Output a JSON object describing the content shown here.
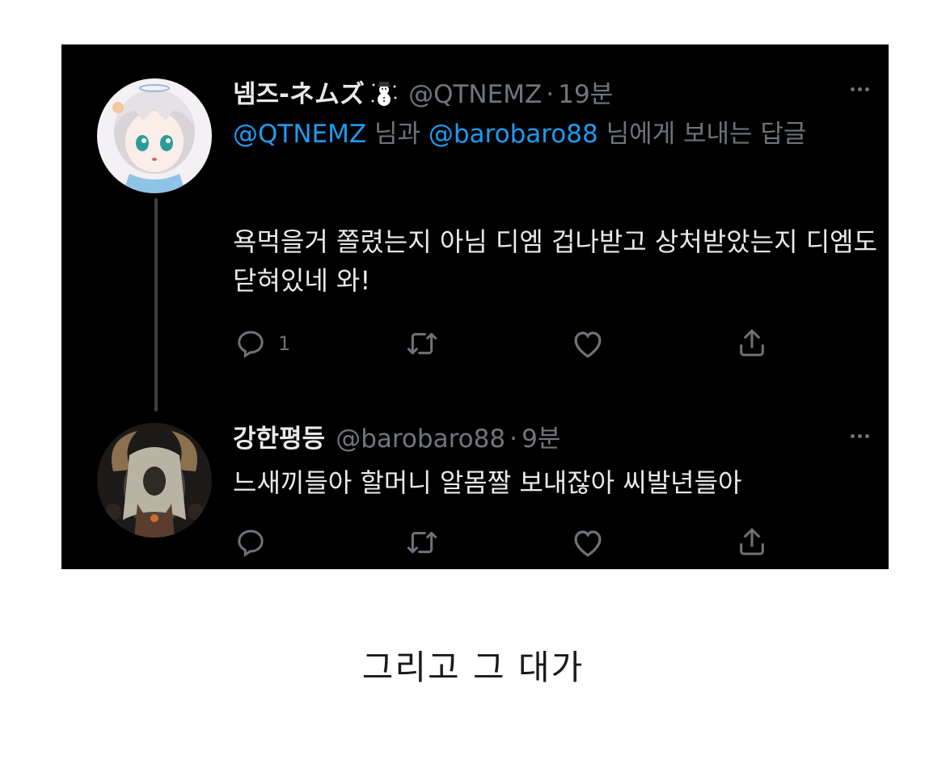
{
  "tweets": [
    {
      "display_name": "넴즈-ネムズ",
      "emoji": "snowman-icon",
      "handle": "@QTNEMZ",
      "separator": "·",
      "time": "19분",
      "reply_to": {
        "user1": "@QTNEMZ",
        "conj1": " 님과 ",
        "user2": "@barobaro88",
        "suffix": " 님에게 보내는 답글"
      },
      "text": "욕먹을거 쫄렸는지 아님 디엠 겁나받고 상처받았는지 디엠도 닫혀있네 와!",
      "reply_count": "1"
    },
    {
      "display_name": "강한평등",
      "handle": "@barobaro88",
      "separator": "·",
      "time": "9분",
      "text": "느새끼들아 할머니 알몸짤 보내잖아 씨발년들아"
    }
  ],
  "caption": "그리고 그 대가",
  "colors": {
    "background": "#000000",
    "mention": "#1d9bf0",
    "muted": "#6e7378",
    "text": "#e8eaeb"
  }
}
